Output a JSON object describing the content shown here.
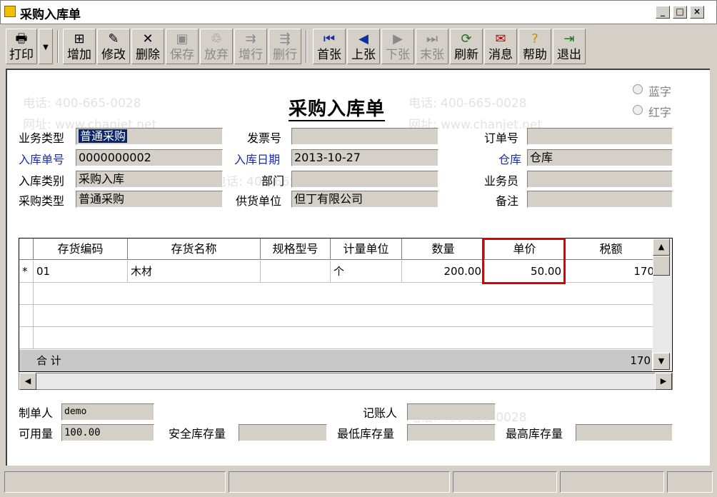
{
  "window": {
    "title": "采购入库单"
  },
  "toolbar": {
    "print": "打印",
    "add": "增加",
    "edit": "修改",
    "delete": "删除",
    "save": "保存",
    "discard": "放弃",
    "add_row": "增行",
    "delete_row": "删行",
    "first": "首张",
    "prev": "上张",
    "next": "下张",
    "last": "末张",
    "refresh": "刷新",
    "message": "消息",
    "help": "帮助",
    "exit": "退出"
  },
  "doc": {
    "title": "采购入库单",
    "radio_blue": "蓝字",
    "radio_red": "红字"
  },
  "header": {
    "business_type_label": "业务类型",
    "business_type": "普通采购",
    "invoice_no_label": "发票号",
    "invoice_no": "",
    "order_no_label": "订单号",
    "order_no": "",
    "receipt_no_label": "入库单号",
    "receipt_no": "0000000002",
    "receipt_date_label": "入库日期",
    "receipt_date": "2013-10-27",
    "warehouse_label": "仓库",
    "warehouse": "仓库",
    "receipt_type_label": "入库类别",
    "receipt_type": "采购入库",
    "dept_label": "部门",
    "dept": "",
    "salesman_label": "业务员",
    "salesman": "",
    "purchase_type_label": "采购类型",
    "purchase_type": "普通采购",
    "supplier_label": "供货单位",
    "supplier": "但丁有限公司",
    "remark_label": "备注",
    "remark": ""
  },
  "grid": {
    "columns": [
      "存货编码",
      "存货名称",
      "规格型号",
      "计量单位",
      "数量",
      "单价",
      "税额"
    ],
    "rows": [
      {
        "marker": "*",
        "code": "01",
        "name": "木材",
        "spec": "",
        "unit": "个",
        "qty": "200.00",
        "price": "50.00",
        "tax": "170"
      }
    ],
    "sum_label": "合  计",
    "sum_tax": "170"
  },
  "footer": {
    "maker_label": "制单人",
    "maker": "demo",
    "bookkeeper_label": "记账人",
    "bookkeeper": "",
    "available_label": "可用量",
    "available": "100.00",
    "safety_label": "安全库存量",
    "safety": "",
    "min_label": "最低库存量",
    "min": "",
    "max_label": "最高库存量",
    "max": ""
  },
  "watermark": {
    "phone": "电话: 400-665-0028",
    "site": "网址: www.chanjet.net"
  }
}
